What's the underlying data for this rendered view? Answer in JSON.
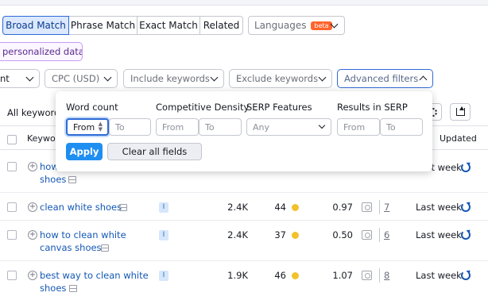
{
  "match_tabs": {
    "broad": "Broad Match",
    "phrase": "Phrase Match",
    "exact": "Exact Match",
    "related": "Related"
  },
  "languages": {
    "label": "Languages",
    "badge": "beta"
  },
  "personalized": {
    "label": "personalized data"
  },
  "filters": {
    "intent_partial": "nt",
    "cpc": "CPC (USD)",
    "include": "Include keywords",
    "exclude": "Exclude keywords",
    "advanced": "Advanced filters"
  },
  "popup": {
    "word_count": {
      "label": "Word count",
      "from_value": "From",
      "to_placeholder": "To"
    },
    "competitive_density": {
      "label": "Competitive Density",
      "from_placeholder": "From",
      "to_placeholder": "To"
    },
    "serp_features": {
      "label": "SERP Features",
      "value": "Any"
    },
    "results": {
      "label": "Results in SERP",
      "from_placeholder": "From",
      "to_placeholder": "To"
    },
    "apply": "Apply",
    "clear": "Clear all fields"
  },
  "table": {
    "all_keywords": "All keyword",
    "col_keyword": "Keywo",
    "col_updated": "Updated",
    "rows": [
      {
        "keyword_l1": "how",
        "keyword_l2": "shoes",
        "updated": "Last week",
        "results_fragment": ""
      },
      {
        "keyword_l1": "clean white shoes",
        "intent": "I",
        "volume": "2.4K",
        "kd": "44",
        "cpc": "0.97",
        "results": "7",
        "updated": "Last week"
      },
      {
        "keyword_l1": "how to clean white",
        "keyword_l2": "canvas shoes",
        "intent": "I",
        "volume": "2.4K",
        "kd": "37",
        "cpc": "0.50",
        "results": "6",
        "updated": "Last week"
      },
      {
        "keyword_l1": "best way to clean white",
        "keyword_l2": "shoes",
        "intent": "I",
        "volume": "1.9K",
        "kd": "46",
        "cpc": "1.07",
        "results": "8",
        "updated": "Last week"
      }
    ]
  },
  "colors": {
    "accent": "#1f8ef1",
    "link": "#1357b5",
    "kd_dot": "#f2c12e",
    "beta": "#ff642d"
  }
}
